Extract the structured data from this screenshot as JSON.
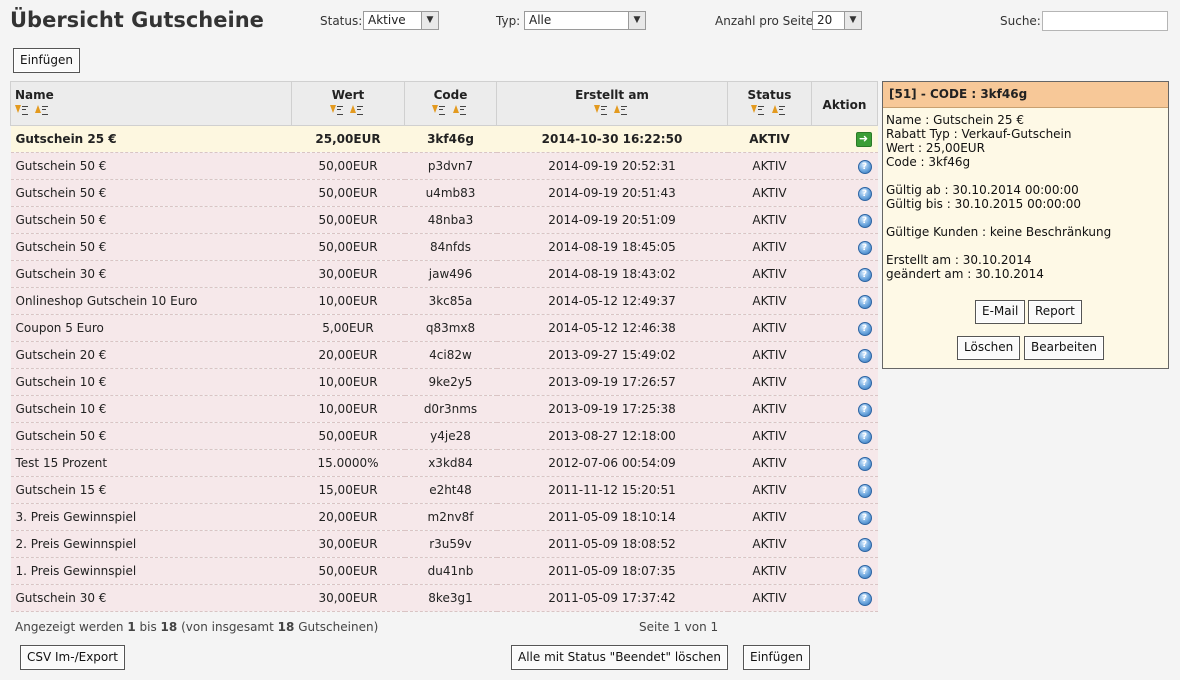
{
  "page_title": "Übersicht Gutscheine",
  "filters": {
    "status_label": "Status:",
    "status_value": "Aktive",
    "type_label": "Typ:",
    "type_value": "Alle",
    "per_page_label": "Anzahl pro Seite:",
    "per_page_value": "20",
    "search_label": "Suche:",
    "search_value": ""
  },
  "buttons": {
    "insert_top": "Einfügen",
    "csv": "CSV Im-/Export",
    "delete_ended": "Alle mit Status \"Beendet\" löschen",
    "insert_bottom": "Einfügen"
  },
  "table": {
    "headers": {
      "name": "Name",
      "value": "Wert",
      "code": "Code",
      "created": "Erstellt am",
      "status": "Status",
      "action": "Aktion"
    },
    "rows": [
      {
        "name": "Gutschein 25 €",
        "value": "25,00EUR",
        "code": "3kf46g",
        "created": "2014-10-30 16:22:50",
        "status": "AKTIV"
      },
      {
        "name": "Gutschein 50 €",
        "value": "50,00EUR",
        "code": "p3dvn7",
        "created": "2014-09-19 20:52:31",
        "status": "AKTIV"
      },
      {
        "name": "Gutschein 50 €",
        "value": "50,00EUR",
        "code": "u4mb83",
        "created": "2014-09-19 20:51:43",
        "status": "AKTIV"
      },
      {
        "name": "Gutschein 50 €",
        "value": "50,00EUR",
        "code": "48nba3",
        "created": "2014-09-19 20:51:09",
        "status": "AKTIV"
      },
      {
        "name": "Gutschein 50 €",
        "value": "50,00EUR",
        "code": "84nfds",
        "created": "2014-08-19 18:45:05",
        "status": "AKTIV"
      },
      {
        "name": "Gutschein 30 €",
        "value": "30,00EUR",
        "code": "jaw496",
        "created": "2014-08-19 18:43:02",
        "status": "AKTIV"
      },
      {
        "name": "Onlineshop Gutschein 10 Euro",
        "value": "10,00EUR",
        "code": "3kc85a",
        "created": "2014-05-12 12:49:37",
        "status": "AKTIV"
      },
      {
        "name": "Coupon 5 Euro",
        "value": "5,00EUR",
        "code": "q83mx8",
        "created": "2014-05-12 12:46:38",
        "status": "AKTIV"
      },
      {
        "name": "Gutschein 20 €",
        "value": "20,00EUR",
        "code": "4ci82w",
        "created": "2013-09-27 15:49:02",
        "status": "AKTIV"
      },
      {
        "name": "Gutschein 10 €",
        "value": "10,00EUR",
        "code": "9ke2y5",
        "created": "2013-09-19 17:26:57",
        "status": "AKTIV"
      },
      {
        "name": "Gutschein 10 €",
        "value": "10,00EUR",
        "code": "d0r3nms",
        "created": "2013-09-19 17:25:38",
        "status": "AKTIV"
      },
      {
        "name": "Gutschein 50 €",
        "value": "50,00EUR",
        "code": "y4je28",
        "created": "2013-08-27 12:18:00",
        "status": "AKTIV"
      },
      {
        "name": "Test 15 Prozent",
        "value": "15.0000%",
        "code": "x3kd84",
        "created": "2012-07-06 00:54:09",
        "status": "AKTIV"
      },
      {
        "name": "Gutschein 15 €",
        "value": "15,00EUR",
        "code": "e2ht48",
        "created": "2011-11-12 15:20:51",
        "status": "AKTIV"
      },
      {
        "name": "3. Preis Gewinnspiel",
        "value": "20,00EUR",
        "code": "m2nv8f",
        "created": "2011-05-09 18:10:14",
        "status": "AKTIV"
      },
      {
        "name": "2. Preis Gewinnspiel",
        "value": "30,00EUR",
        "code": "r3u59v",
        "created": "2011-05-09 18:08:52",
        "status": "AKTIV"
      },
      {
        "name": "1. Preis Gewinnspiel",
        "value": "50,00EUR",
        "code": "du41nb",
        "created": "2011-05-09 18:07:35",
        "status": "AKTIV"
      },
      {
        "name": "Gutschein 30 €",
        "value": "30,00EUR",
        "code": "8ke3g1",
        "created": "2011-05-09 17:37:42",
        "status": "AKTIV"
      }
    ]
  },
  "footer": {
    "shown_prefix": "Angezeigt werden",
    "from": "1",
    "to_word": "bis",
    "to": "18",
    "total_prefix": "(von insgesamt",
    "total": "18",
    "total_suffix": "Gutscheinen)",
    "page_info": "Seite 1 von 1"
  },
  "detail_panel": {
    "header": "[51] - CODE : 3kf46g",
    "lines_block1": [
      "Name : Gutschein 25 €",
      "Rabatt Typ : Verkauf-Gutschein",
      "Wert : 25,00EUR",
      "Code : 3kf46g"
    ],
    "lines_block2": [
      "Gültig ab : 30.10.2014 00:00:00",
      "Gültig bis : 30.10.2015 00:00:00"
    ],
    "lines_block3": [
      "Gültige Kunden : keine Beschränkung"
    ],
    "lines_block4": [
      "Erstellt am : 30.10.2014",
      "geändert am : 30.10.2014"
    ],
    "buttons": {
      "email": "E-Mail",
      "report": "Report",
      "delete": "Löschen",
      "edit": "Bearbeiten"
    }
  }
}
